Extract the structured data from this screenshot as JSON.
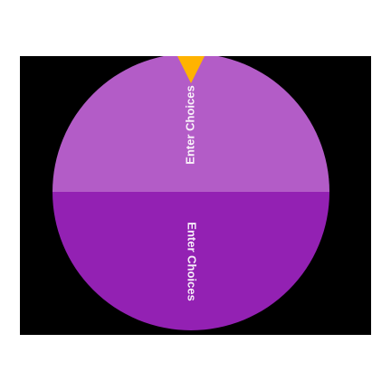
{
  "wheel": {
    "segments": [
      {
        "label": "Enter Choices",
        "color": "#B35CC7"
      },
      {
        "label": "Enter Choices",
        "color": "#9321B3"
      }
    ],
    "pointer_color": "#FFB300",
    "background_color": "#000000"
  }
}
